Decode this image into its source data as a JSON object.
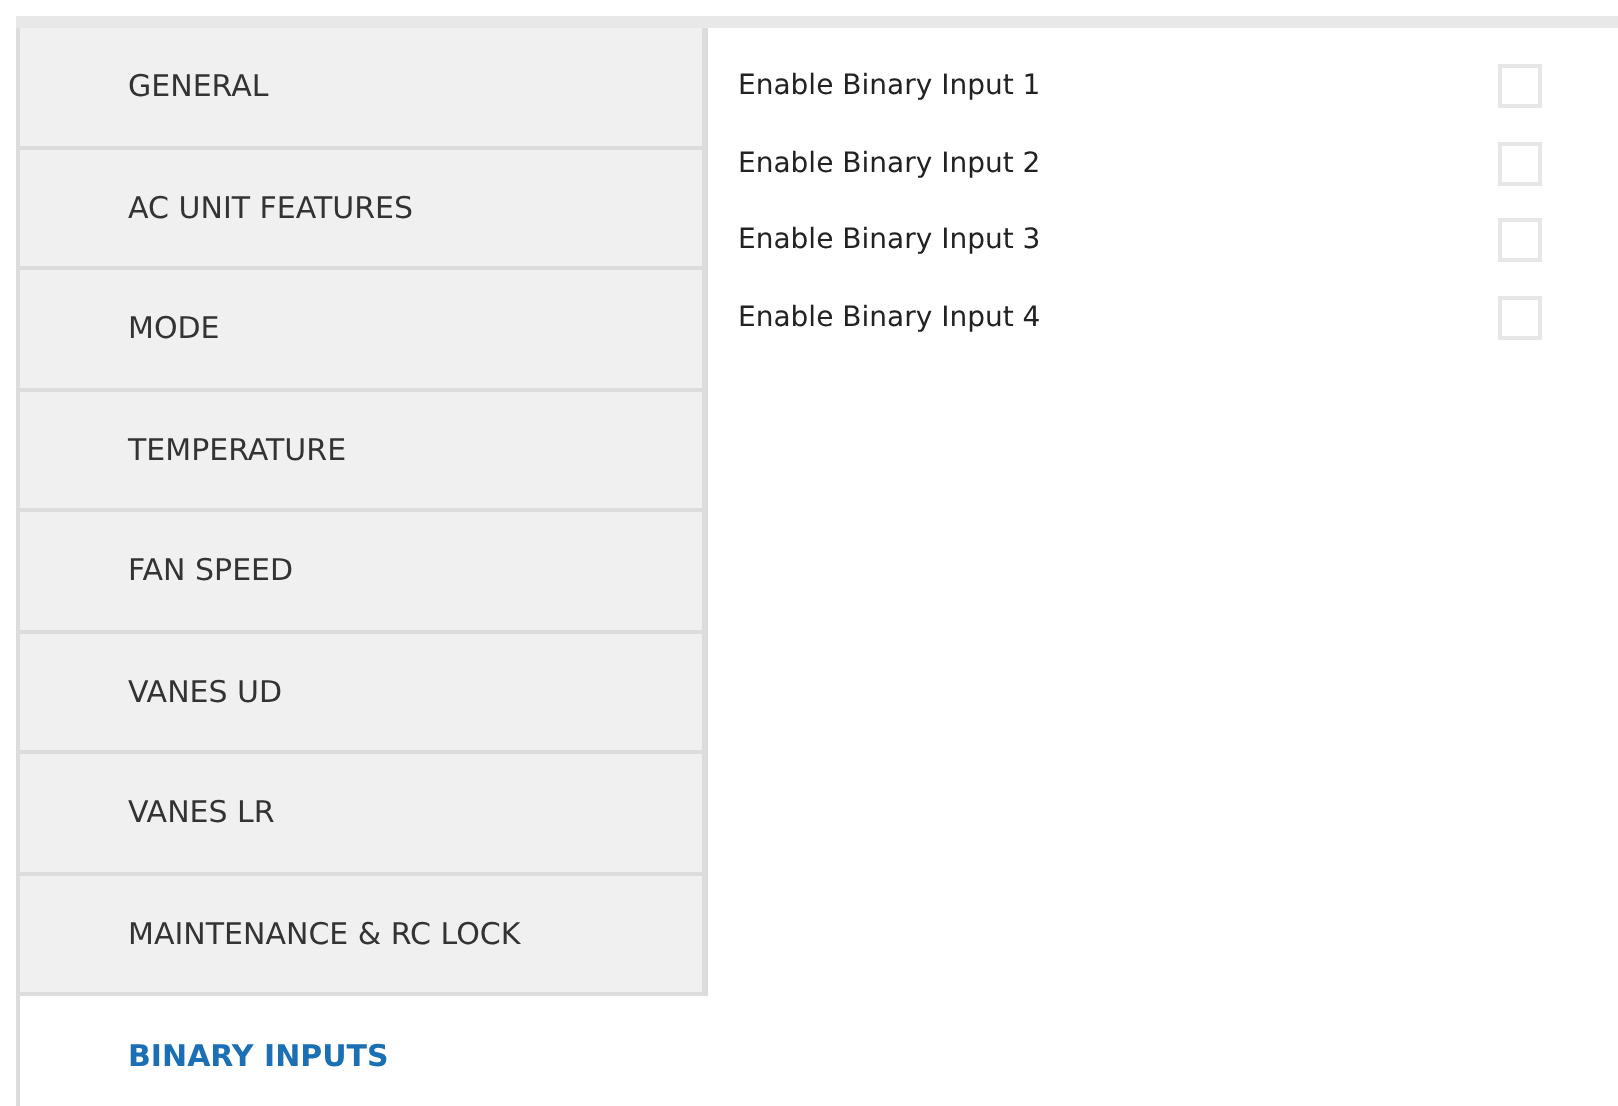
{
  "tabs": [
    {
      "label": "GENERAL",
      "selected": false
    },
    {
      "label": "AC UNIT FEATURES",
      "selected": false
    },
    {
      "label": "MODE",
      "selected": false
    },
    {
      "label": "TEMPERATURE",
      "selected": false
    },
    {
      "label": "FAN SPEED",
      "selected": false
    },
    {
      "label": "VANES UD",
      "selected": false
    },
    {
      "label": "VANES LR",
      "selected": false
    },
    {
      "label": "MAINTENANCE & RC LOCK",
      "selected": false
    },
    {
      "label": "BINARY INPUTS",
      "selected": true
    }
  ],
  "options": [
    {
      "label": "Enable Binary Input 1",
      "checked": false
    },
    {
      "label": "Enable Binary Input 2",
      "checked": false
    },
    {
      "label": "Enable Binary Input 3",
      "checked": false
    },
    {
      "label": "Enable Binary Input 4",
      "checked": false
    }
  ]
}
